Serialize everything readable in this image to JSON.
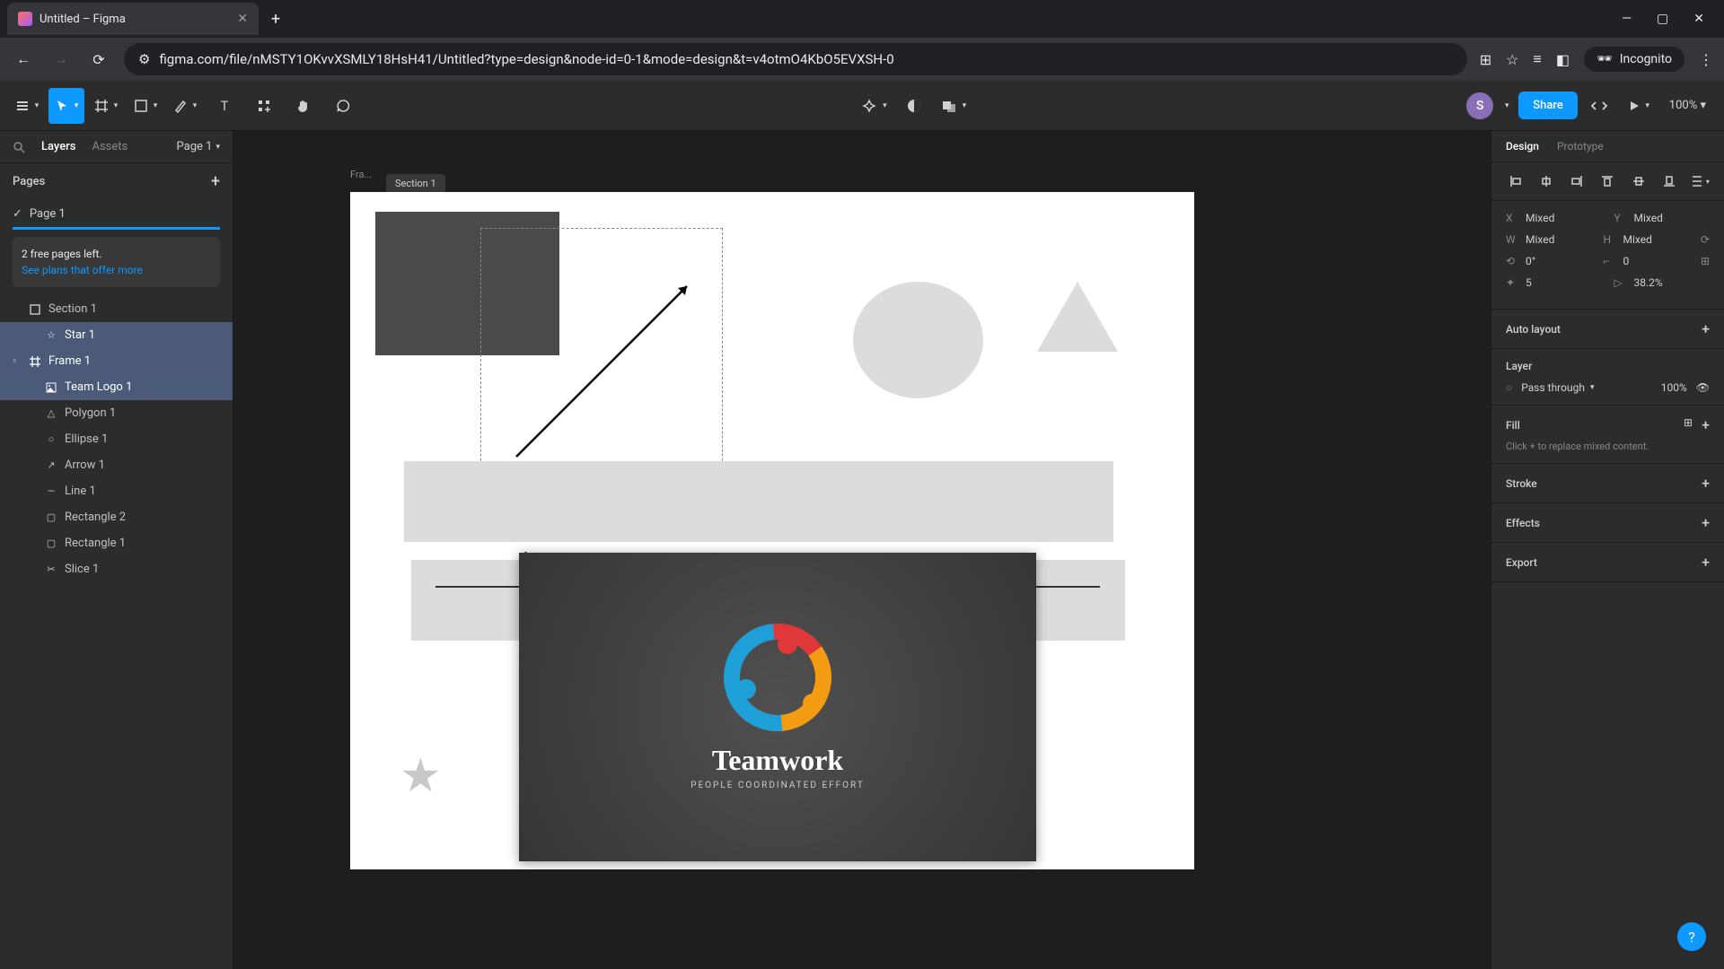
{
  "browser": {
    "tab_title": "Untitled – Figma",
    "url": "figma.com/file/nMSTY1OKvvXSMLY18HsH41/Untitled?type=design&node-id=0-1&mode=design&t=v4otmO4KbO5EVXSH-0",
    "incognito_label": "Incognito"
  },
  "toolbar": {
    "avatar_initial": "S",
    "share_label": "Share",
    "zoom": "100%"
  },
  "left_panel": {
    "layers_tab": "Layers",
    "assets_tab": "Assets",
    "page_selector": "Page 1",
    "pages_header": "Pages",
    "current_page": "Page 1",
    "banner_line1": "2 free pages left.",
    "banner_link": "See plans that offer more",
    "layers": [
      {
        "name": "Section 1",
        "icon": "section",
        "indent": 0,
        "selected": false,
        "expandable": false
      },
      {
        "name": "Star 1",
        "icon": "star",
        "indent": 1,
        "selected": true,
        "expandable": false
      },
      {
        "name": "Frame 1",
        "icon": "frame",
        "indent": 0,
        "selected": true,
        "expandable": true,
        "expanded": true
      },
      {
        "name": "Team Logo 1",
        "icon": "image",
        "indent": 1,
        "selected": true,
        "expandable": false
      },
      {
        "name": "Polygon 1",
        "icon": "polygon",
        "indent": 1,
        "selected": false,
        "expandable": false
      },
      {
        "name": "Ellipse 1",
        "icon": "ellipse",
        "indent": 1,
        "selected": false,
        "expandable": false
      },
      {
        "name": "Arrow 1",
        "icon": "arrow",
        "indent": 1,
        "selected": false,
        "expandable": false
      },
      {
        "name": "Line 1",
        "icon": "line",
        "indent": 1,
        "selected": false,
        "expandable": false
      },
      {
        "name": "Rectangle 2",
        "icon": "rect",
        "indent": 1,
        "selected": false,
        "expandable": false
      },
      {
        "name": "Rectangle 1",
        "icon": "rect",
        "indent": 1,
        "selected": false,
        "expandable": false
      },
      {
        "name": "Slice 1",
        "icon": "slice",
        "indent": 1,
        "selected": false,
        "expandable": false
      }
    ]
  },
  "canvas": {
    "frame_label": "Fra...",
    "section_tag": "Section 1",
    "logo_title": "Teamwork",
    "logo_subtitle": "People Coordinated Effort"
  },
  "right_panel": {
    "design_tab": "Design",
    "prototype_tab": "Prototype",
    "transform": {
      "x_label": "X",
      "x_val": "Mixed",
      "y_label": "Y",
      "y_val": "Mixed",
      "w_label": "W",
      "w_val": "Mixed",
      "h_label": "H",
      "h_val": "Mixed",
      "rot_val": "0°",
      "radius_val": "0",
      "count_val": "5",
      "ratio_val": "38.2%"
    },
    "auto_layout": "Auto layout",
    "layer_header": "Layer",
    "blend_mode": "Pass through",
    "opacity": "100%",
    "fill_header": "Fill",
    "fill_hint": "Click + to replace mixed content.",
    "stroke_header": "Stroke",
    "effects_header": "Effects",
    "export_header": "Export"
  }
}
